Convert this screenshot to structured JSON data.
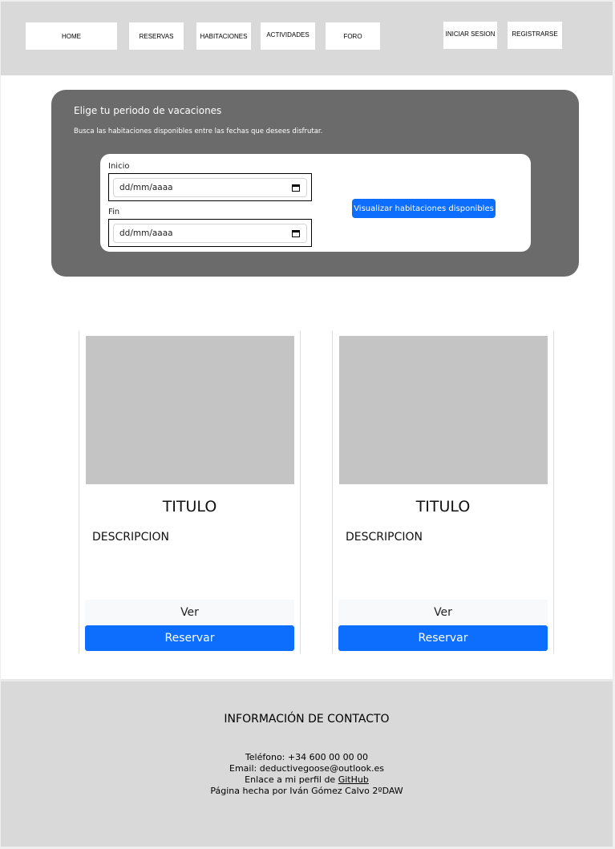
{
  "nav": {
    "home": "HOME",
    "reservas": "RESERVAS",
    "habitaciones": "HABITACIONES",
    "actividades": "ACTIVIDADES",
    "foro": "FORO",
    "login": "INICIAR SESION",
    "register": "REGISTRARSE"
  },
  "search": {
    "title": "Elige tu periodo de vacaciones",
    "subtitle": "Busca las habitaciones disponibles entre las fechas que desees disfrutar.",
    "start_label": "Inicio",
    "start_value": "dd/mm/aaaa",
    "end_label": "Fin",
    "end_value": "dd/mm/aaaa",
    "submit_label": "Visualizar habitaciones disponibles"
  },
  "cards": [
    {
      "title": "TITULO",
      "description": "DESCRIPCION",
      "view_label": "Ver",
      "book_label": "Reservar"
    },
    {
      "title": "TITULO",
      "description": "DESCRIPCION",
      "view_label": "Ver",
      "book_label": "Reservar"
    }
  ],
  "footer": {
    "title": "INFORMACIÓN DE CONTACTO",
    "phone": "Teléfono: +34 600 00 00 00",
    "email": "Email: deductivegoose@outlook.es",
    "profile_prefix": "Enlace a mi perfil de ",
    "profile_link": "GitHub",
    "credits": "Página hecha por Iván Gómez Calvo 2ºDAW"
  },
  "colors": {
    "primary": "#0d6efd",
    "panel": "#6b6b6b",
    "header": "#d9d9d9",
    "placeholder_image": "#c4c4c4"
  }
}
